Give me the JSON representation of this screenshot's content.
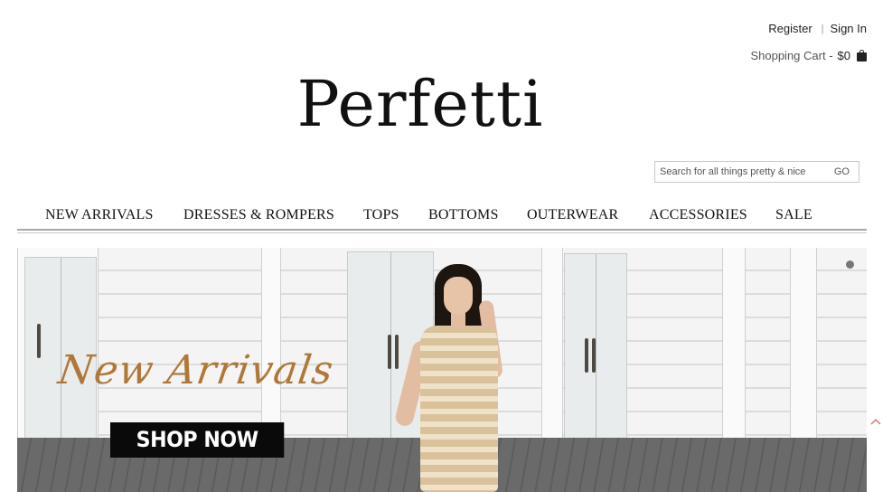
{
  "header": {
    "register_label": "Register",
    "separator": "|",
    "signin_label": "Sign In",
    "cart_label": "Shopping Cart -",
    "cart_total": "$0",
    "cart_icon": "shopping-bag-icon"
  },
  "logo": {
    "text": "Perfetti"
  },
  "search": {
    "placeholder": "Search for all things pretty & nice",
    "button_label": "GO"
  },
  "nav": {
    "items": [
      {
        "label": "NEW ARRIVALS"
      },
      {
        "label": "DRESSES & ROMPERS"
      },
      {
        "label": "TOPS"
      },
      {
        "label": "BOTTOMS"
      },
      {
        "label": "OUTERWEAR"
      },
      {
        "label": "ACCESSORIES"
      },
      {
        "label": "SALE"
      }
    ]
  },
  "hero": {
    "headline": "New Arrivals",
    "cta_label": "SHOP NOW",
    "slider_dots": 1,
    "headline_color": "#b07838"
  },
  "colors": {
    "text": "#111111",
    "cta_bg": "#0a0a0a",
    "rule": "#a7a7a7"
  }
}
